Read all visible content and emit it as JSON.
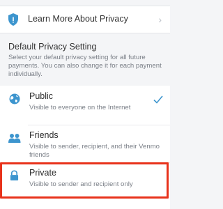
{
  "learn_more": {
    "label": "Learn More About Privacy",
    "icon": "shield-icon"
  },
  "section": {
    "title": "Default Privacy Setting",
    "description": "Select your default privacy setting for all future payments. You can also change it for each payment individually."
  },
  "options": [
    {
      "title": "Public",
      "description": "Visible to everyone on the Internet",
      "icon": "globe-icon",
      "selected": true
    },
    {
      "title": "Friends",
      "description": "Visible to sender, recipient, and their Venmo friends",
      "icon": "friends-icon",
      "selected": false
    },
    {
      "title": "Private",
      "description": "Visible to sender and recipient only",
      "icon": "lock-icon",
      "selected": false
    }
  ],
  "colors": {
    "accent": "#3d95ce",
    "highlight": "#e8321b"
  }
}
